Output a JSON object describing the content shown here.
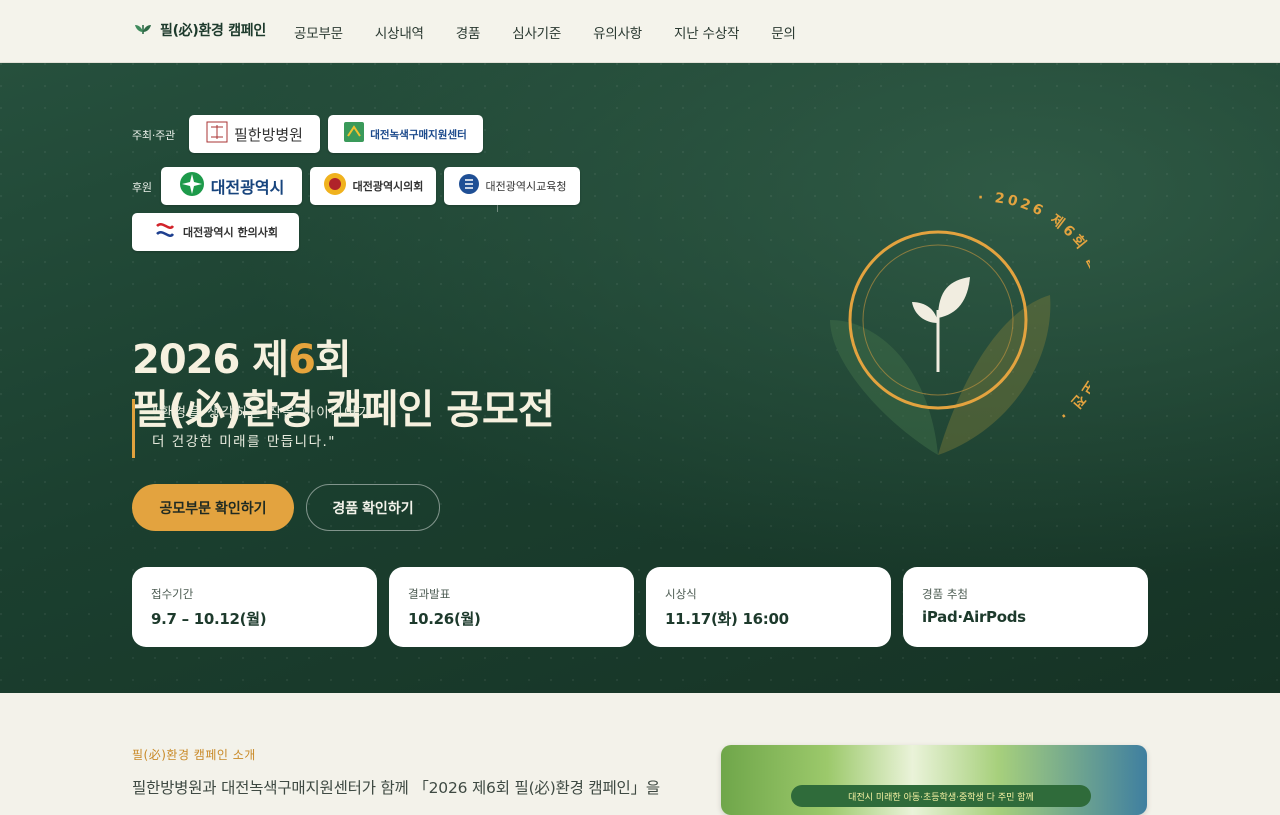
{
  "nav": {
    "brand": "필(必)환경 캠페인",
    "items": [
      "공모부문",
      "시상내역",
      "경품",
      "심사기준",
      "유의사항",
      "지난 수상작",
      "문의"
    ]
  },
  "hero": {
    "host_label": "주최·주관",
    "sponsor_label": "후원",
    "hosts": [
      "필한방병원",
      "대전녹색구매지원센터"
    ],
    "sponsors": [
      "대전광역시",
      "대전광역시의회",
      "대전광역시교육청",
      "대전광역시 한의사회"
    ],
    "title_line1_pre": "2026 제",
    "title_line1_accent": "6",
    "title_line1_post": "회",
    "title_line2": "필(必)환경 캠페인 공모전",
    "quote_line1": "\"환경을 생각하는 작은 아이디어가",
    "quote_line2": "더 건강한 미래를 만듭니다.\"",
    "primary_button": "공모부문 확인하기",
    "secondary_button": "경품 확인하기",
    "emblem_text": "· 2026 제6회 필한경 캠페인 공모전 ·"
  },
  "info_cards": [
    {
      "label": "접수기간",
      "value": "9.7 – 10.12(월)"
    },
    {
      "label": "결과발표",
      "value": "10.26(월)"
    },
    {
      "label": "시상식",
      "value": "11.17(화) 16:00"
    },
    {
      "label": "경품 추첨",
      "value": "iPad·AirPods"
    }
  ],
  "intro": {
    "tag": "필(必)환경 캠페인 소개",
    "text": "필한방병원과 대전녹색구매지원센터가 함께 「2026 제6회 필(必)환경 캠페인」을",
    "poster_text": "대전시 미래한 아동·초등학생·중학생 다 주민 함께"
  },
  "colors": {
    "accent": "#e3a33f",
    "hero_bg": "#1b3f2f",
    "brand_green": "#1d3a2c"
  }
}
